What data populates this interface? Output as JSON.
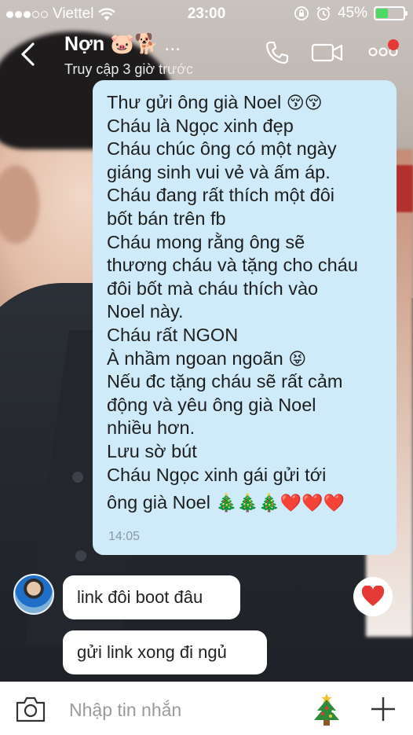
{
  "status_bar": {
    "carrier": "Viettel",
    "time": "23:00",
    "battery_percent": "45%",
    "battery_level": 0.45,
    "signal_filled": 3,
    "signal_total": 5
  },
  "header": {
    "name": "Nợn",
    "name_emojis": "🐷🐕 ...",
    "subtitle": "Truy cập 3 giờ trước"
  },
  "messages": {
    "outgoing": {
      "lines": [
        "Thư gửi ông già Noel",
        "Cháu là Ngọc xinh đẹp",
        "Cháu chúc ông có một ngày",
        "giáng sinh vui vẻ và ấm áp.",
        "Cháu đang rất thích một đôi",
        "bốt bán trên fb",
        "Cháu mong rằng ông sẽ",
        "thương cháu và tặng cho cháu",
        "đôi bốt mà cháu thích vào",
        "Noel này.",
        "Cháu rất NGON",
        "À nhầm ngoan ngoãn",
        "Nếu đc tặng cháu sẽ rất cảm",
        "động và yêu ông già Noel",
        "nhiều hơn.",
        "Lưu sờ bút",
        "Cháu Ngọc xinh gái gửi tới",
        "ông già Noel"
      ],
      "line1_emoji": "😚😚",
      "line12_emoji": "😝",
      "last_line_emoji": "🎄🎄🎄❤️❤️❤️",
      "timestamp": "14:05"
    },
    "incoming": [
      {
        "text": "link đôi boot đâu"
      },
      {
        "text": "gửi link xong đi ngủ"
      }
    ]
  },
  "input": {
    "placeholder": "Nhập tin nhắn",
    "sticker_icon": "christmas-tree-icon"
  },
  "colors": {
    "outgoing_bubble": "#cfeaf8",
    "incoming_bubble": "#ffffff",
    "notification_dot": "#e53935",
    "like_heart": "#e53935",
    "battery_fill": "#4cd964"
  }
}
